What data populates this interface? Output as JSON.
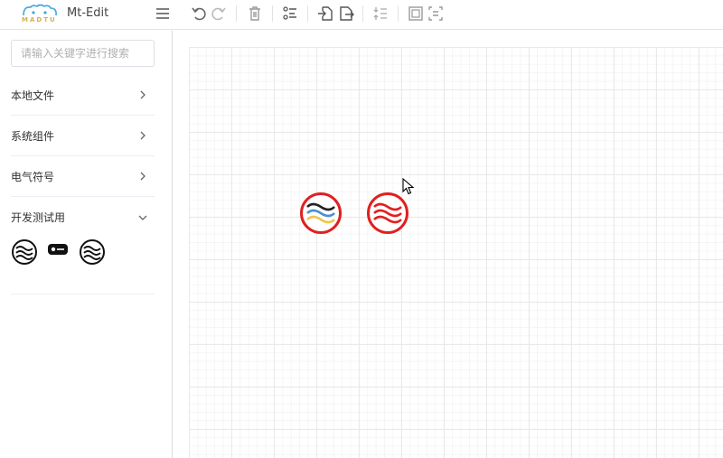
{
  "header": {
    "logo_text": "MADTU",
    "title": "Mt-Edit",
    "toolbar": [
      {
        "icon": "menu-icon"
      },
      {
        "icon": "undo-icon"
      },
      {
        "icon": "redo-icon"
      },
      {
        "icon": "delete-icon"
      },
      {
        "icon": "list-icon"
      },
      {
        "icon": "import-icon"
      },
      {
        "icon": "export-icon"
      },
      {
        "icon": "align-center-icon"
      },
      {
        "icon": "fit-icon"
      },
      {
        "icon": "distribute-icon"
      }
    ]
  },
  "sidebar": {
    "search_placeholder": "请输入关键字进行搜索",
    "categories": [
      {
        "label": "本地文件",
        "expanded": false
      },
      {
        "label": "系统组件",
        "expanded": false
      },
      {
        "label": "电气符号",
        "expanded": false
      },
      {
        "label": "开发测试用",
        "expanded": true
      }
    ],
    "dev_symbols": [
      "wave-circle-symbol",
      "switch-symbol",
      "wave-circle-outline-symbol"
    ]
  },
  "canvas": {
    "shapes": [
      "colored-wave-circle",
      "red-wave-circle"
    ]
  },
  "colors": {
    "accent_red": "#e02020",
    "wave_dark": "#222222",
    "wave_blue": "#4a8fd4",
    "wave_yellow": "#f0c54a"
  }
}
